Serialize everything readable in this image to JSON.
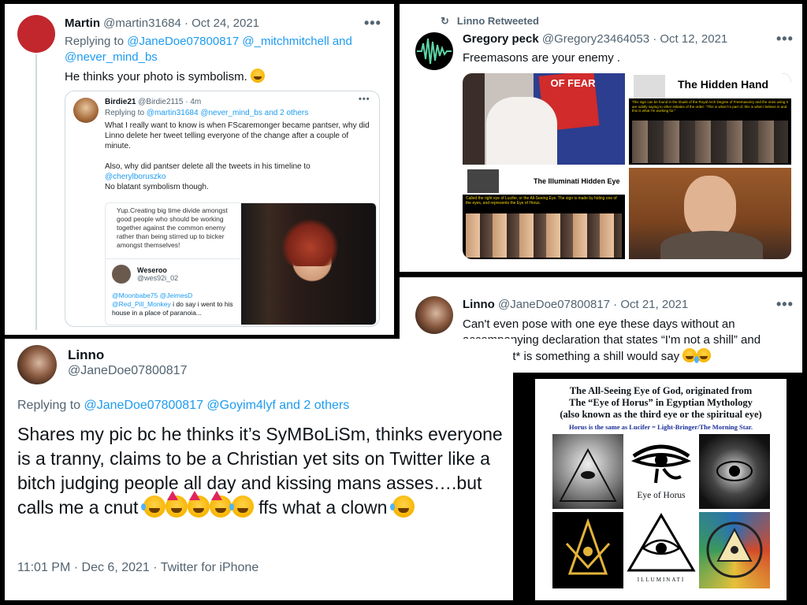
{
  "p1": {
    "name": "Martin",
    "handle": "@martin31684 · Oct 24, 2021",
    "reply_prefix": "Replying to",
    "reply_to": "@JaneDoe07800817 @_mitchmitchell and",
    "reply_to2": "@never_mind_bs",
    "text": "He thinks your photo is symbolism.",
    "quote": {
      "name": "Birdie21",
      "meta": "@Birdie2115 · 4m",
      "reply_prefix": "Replying to",
      "reply_to": "@martin31684 @never_mind_bs and 2 others",
      "body1": "What I really want to know is when FScaremonger became  pantser, why did Linno delete her tweet telling everyone of the change after a couple of minute.",
      "body2": "Also, why did pantser delete all the tweets in his timeline to",
      "body2_link": "@cherylboruszko",
      "body3": "No blatant symbolism though.",
      "inner_text": "Yup.Creating big time divide amongst good people who should be working together against the common enemy rather than being stirred up to bicker amongst themselves!",
      "inner_name": "Weseroo",
      "inner_handle": "@wes92i_02",
      "inner_links": "@Moonbabe75 @JeimesD",
      "inner_link2": "@Red_Pill_Monkey",
      "inner_reply": " i do say i went to his house in a place of paranoia..."
    }
  },
  "p2": {
    "retweet_label": "Linno Retweeted",
    "name": "Gregory peck",
    "handle": "@Gregory23464053 · Oct 12, 2021",
    "text": "Freemasons are your enemy .",
    "img_fear": "OF FEAR",
    "img_hidden_hand": "The Hidden Hand",
    "img_hidden_hand_caption": "This sign can be found in the rituals of the Royal Arch Degree of Freemasonry and the ones using it are subtly saying to other initiates of the order: \"This is what I'm part of, this is what I believe in and this is what I'm working for.\"",
    "img_hidden_eye": "The Illuminati Hidden Eye",
    "img_hidden_eye_caption": "Called the right eye of Lucifer, or the All-Seeing Eye. The sign is made by hiding one of the eyes, and represents the Eye of Horus."
  },
  "p3": {
    "name": "Linno",
    "handle": "@JaneDoe07800817 · Oct 21, 2021",
    "text": "Can't even pose with one eye these days without an accompanying declaration that states “I'm not a shill” and even *that* is something a shill would say"
  },
  "p4": {
    "name": "Linno",
    "handle": "@JaneDoe07800817",
    "reply_prefix": "Replying to",
    "reply_to": "@JaneDoe07800817 @Goyim4lyf and 2 others",
    "text": "Shares my pic bc he thinks it’s SyMBoLiSm, thinks everyone is a tranny, claims to be a Christian yet sits on Twitter like a bitch judging people all day and kissing mans asses….but calls me a cnut",
    "text_tail": " ffs what a clown",
    "meta": "11:01 PM · Dec 6, 2021 · Twitter for iPhone"
  },
  "p5": {
    "title1": "The All-Seeing Eye of God, originated from",
    "title2": "The “Eye of Horus” in Egyptian Mythology",
    "title3": "(also known as the third eye or the spiritual eye)",
    "subtitle": "Horus is the same as Lucifer = Light-Bringer/The Morning Star.",
    "eye_label": "Eye of Horus",
    "illuminati": "ILLUMINATI"
  },
  "dots": "•••"
}
